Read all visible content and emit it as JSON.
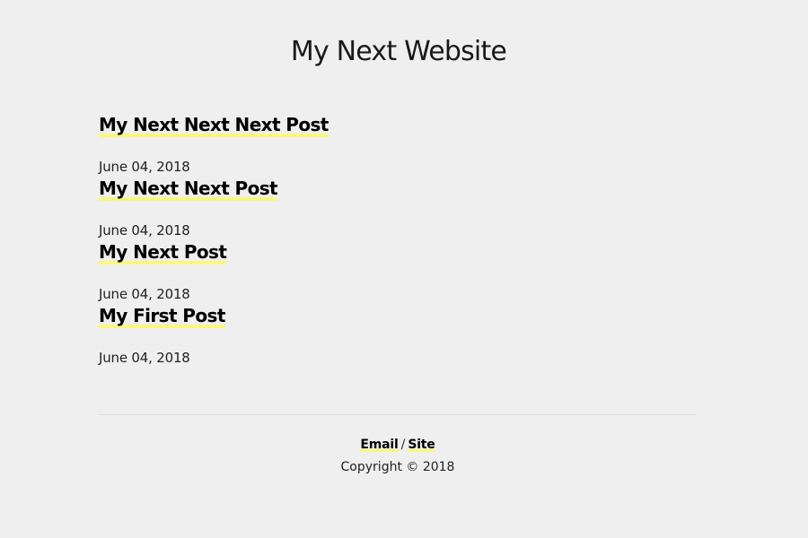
{
  "site": {
    "title": "My Next Website"
  },
  "posts": [
    {
      "title": "My Next Next Next Post",
      "date": "June 04, 2018"
    },
    {
      "title": "My Next Next Post",
      "date": "June 04, 2018"
    },
    {
      "title": "My Next Post",
      "date": "June 04, 2018"
    },
    {
      "title": "My First Post",
      "date": "June 04, 2018"
    }
  ],
  "footer": {
    "email_label": "Email",
    "separator": "/",
    "site_label": "Site",
    "copyright": "Copyright © 2018"
  },
  "colors": {
    "background": "#efefef",
    "highlight": "#fbf87a",
    "text": "#111111"
  }
}
